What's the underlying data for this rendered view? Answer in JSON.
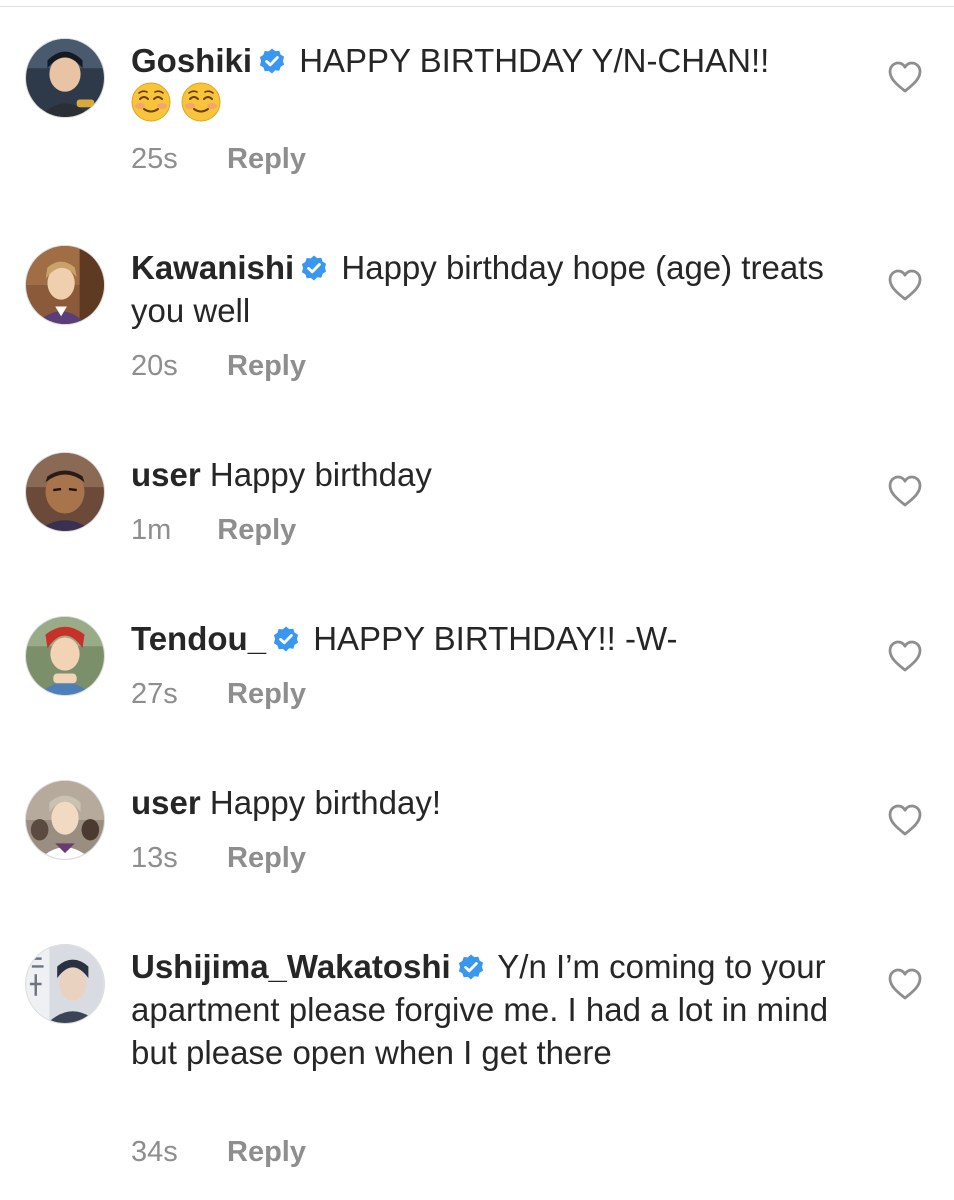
{
  "comments": [
    {
      "username": "Goshiki",
      "verified": true,
      "text": "HAPPY BIRTHDAY Y/N-CHAN!!",
      "emojis": [
        "smiling-face-icon",
        "smiling-face-icon"
      ],
      "time": "25s",
      "reply_label": "Reply"
    },
    {
      "username": "Kawanishi",
      "verified": true,
      "text": "Happy birthday hope (age) treats you well",
      "time": "20s",
      "reply_label": "Reply"
    },
    {
      "username": "user",
      "verified": false,
      "text": "Happy birthday",
      "time": "1m",
      "reply_label": "Reply"
    },
    {
      "username": "Tendou_",
      "verified": true,
      "text": "HAPPY BIRTHDAY!! -W-",
      "time": "27s",
      "reply_label": "Reply"
    },
    {
      "username": "user",
      "verified": false,
      "text": "Happy birthday!",
      "time": "13s",
      "reply_label": "Reply"
    },
    {
      "username": "Ushijima_Wakatoshi",
      "verified": true,
      "text": "Y/n I’m coming to your apartment please forgive me. I had a lot in mind but please open when I get there",
      "time": "34s",
      "reply_label": "Reply"
    }
  ],
  "colors": {
    "text": "#262626",
    "meta": "#8e8e8e",
    "verified_badge": "#3897f0",
    "like_icon": "#8e8e8e"
  }
}
